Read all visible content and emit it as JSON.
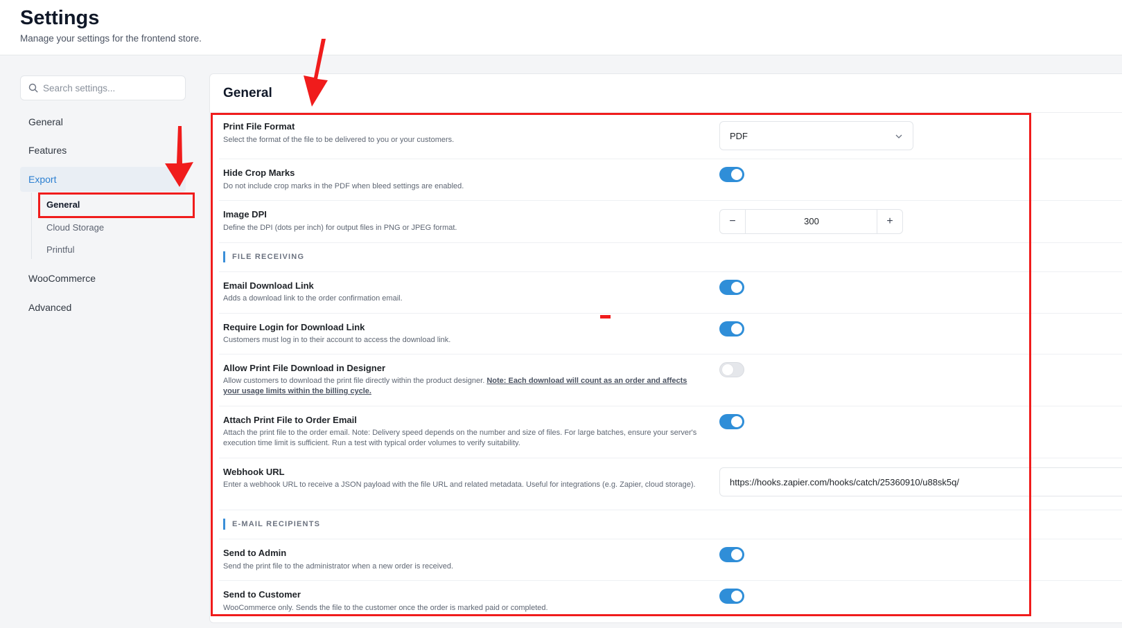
{
  "header": {
    "title": "Settings",
    "subtitle": "Manage your settings for the frontend store."
  },
  "sidebar": {
    "search_placeholder": "Search settings...",
    "items": [
      {
        "label": "General"
      },
      {
        "label": "Features"
      },
      {
        "label": "Export",
        "active": true
      },
      {
        "label": "WooCommerce"
      },
      {
        "label": "Advanced"
      }
    ],
    "export_subitems": [
      {
        "label": "General",
        "active": true
      },
      {
        "label": "Cloud Storage"
      },
      {
        "label": "Printful"
      }
    ]
  },
  "main": {
    "title": "General",
    "settings": {
      "print_file_format": {
        "label": "Print File Format",
        "description": "Select the format of the file to be delivered to you or your customers.",
        "value": "PDF"
      },
      "hide_crop_marks": {
        "label": "Hide Crop Marks",
        "description": "Do not include crop marks in the PDF when bleed settings are enabled.",
        "enabled": true
      },
      "image_dpi": {
        "label": "Image DPI",
        "description": "Define the DPI (dots per inch) for output files in PNG or JPEG format.",
        "value": "300",
        "minus": "−",
        "plus": "+"
      },
      "email_download_link": {
        "label": "Email Download Link",
        "description": "Adds a download link to the order confirmation email.",
        "enabled": true
      },
      "require_login": {
        "label": "Require Login for Download Link",
        "description": "Customers must log in to their account to access the download link.",
        "enabled": true
      },
      "allow_download_designer": {
        "label": "Allow Print File Download in Designer",
        "description": "Allow customers to download the print file directly within the product designer.",
        "note": "Note: Each download will count as an order and affects your usage limits within the billing cycle.",
        "enabled": false
      },
      "attach_print_file": {
        "label": "Attach Print File to Order Email",
        "description": "Attach the print file to the order email. Note: Delivery speed depends on the number and size of files. For large batches, ensure your server's execution time limit is sufficient. Run a test with typical order volumes to verify suitability.",
        "enabled": true
      },
      "webhook_url": {
        "label": "Webhook URL",
        "description": "Enter a webhook URL to receive a JSON payload with the file URL and related metadata. Useful for integrations (e.g. Zapier, cloud storage).",
        "value": "https://hooks.zapier.com/hooks/catch/25360910/u88sk5q/"
      },
      "send_to_admin": {
        "label": "Send to Admin",
        "description": "Send the print file to the administrator when a new order is received.",
        "enabled": true
      },
      "send_to_customer": {
        "label": "Send to Customer",
        "description": "WooCommerce only. Sends the file to the customer once the order is marked paid or completed.",
        "enabled": true
      }
    },
    "sections": {
      "file_receiving": "FILE RECEIVING",
      "email_recipients": "E-MAIL RECIPIENTS"
    }
  },
  "colors": {
    "accent": "#2f8ed8",
    "annotation": "#f01c1c"
  }
}
